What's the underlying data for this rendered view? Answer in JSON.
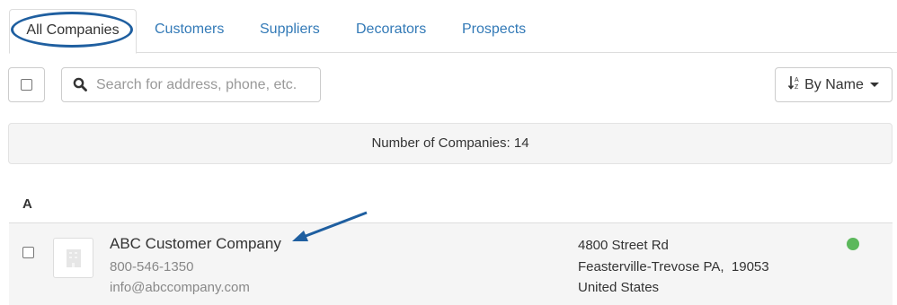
{
  "tabs": [
    {
      "label": "All Companies",
      "active": true
    },
    {
      "label": "Customers"
    },
    {
      "label": "Suppliers"
    },
    {
      "label": "Decorators"
    },
    {
      "label": "Prospects"
    }
  ],
  "search": {
    "placeholder": "Search for address, phone, etc."
  },
  "sort": {
    "label": "By Name",
    "icon": "sort-alpha-asc-icon"
  },
  "summary": {
    "count_text": "Number of Companies: 14"
  },
  "groups": [
    {
      "letter": "A",
      "companies": [
        {
          "name": "ABC Customer Company",
          "phone": "800-546-1350",
          "email": "info@abccompany.com",
          "address_line1": "4800 Street Rd",
          "address_line2": "Feasterville-Trevose PA,  19053",
          "address_line3": "United States",
          "status_color": "#5cb85c"
        }
      ]
    }
  ],
  "colors": {
    "accent": "#337ab7",
    "annotation": "#1f5fa0"
  }
}
